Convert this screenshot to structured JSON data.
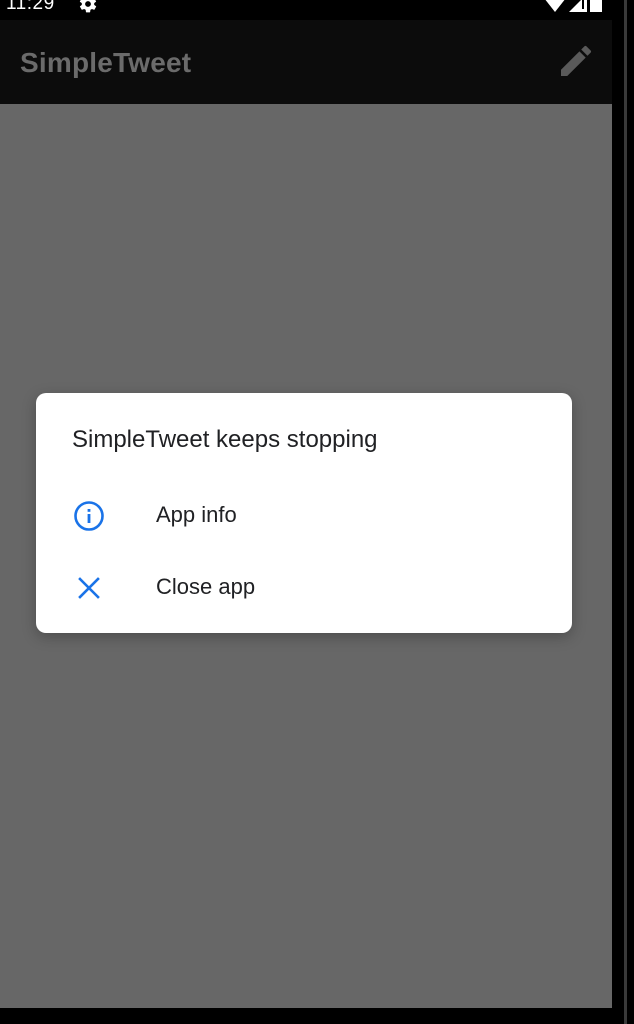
{
  "status_bar": {
    "time": "11:29",
    "gear_icon": "gear-icon",
    "wifi_icon": "wifi-icon",
    "signal_icon": "signal-icon",
    "battery_icon": "battery-icon"
  },
  "toolbar": {
    "title": "SimpleTweet",
    "compose_icon": "pencil-icon"
  },
  "dialog": {
    "title": "SimpleTweet keeps stopping",
    "options": [
      {
        "label": "App info",
        "icon": "info-icon"
      },
      {
        "label": "Close app",
        "icon": "close-icon"
      }
    ]
  },
  "colors": {
    "toolbar_bg": "#0c0c0c",
    "title_color": "#6b6b6b",
    "scrim": "#676767",
    "dialog_bg": "#ffffff",
    "accent": "#1a73e8",
    "text": "#202124"
  }
}
